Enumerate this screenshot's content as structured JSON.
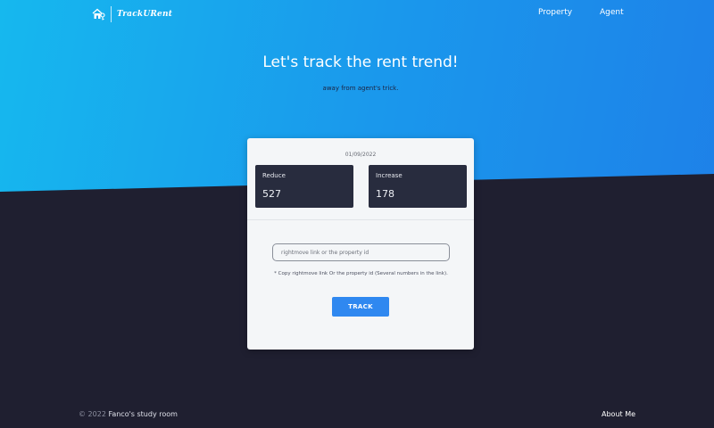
{
  "navbar": {
    "brand_name": "TrackURent",
    "links": [
      {
        "label": "Property"
      },
      {
        "label": "Agent"
      }
    ]
  },
  "hero": {
    "title": "Let's track the rent trend!",
    "subtitle": "away from agent's trick."
  },
  "card": {
    "date": "01/09/2022",
    "stats": {
      "reduce": {
        "label": "Reduce",
        "value": "527"
      },
      "increase": {
        "label": "Increase",
        "value": "178"
      }
    },
    "input": {
      "value": "",
      "placeholder": "rightmove link or the property id"
    },
    "hint": "* Copy rightmove link Or the property id (Several numbers in the link).",
    "button_label": "TRACK"
  },
  "footer": {
    "copyright": "© 2022",
    "owner": "Fanco's study room",
    "about_label": "About Me"
  },
  "colors": {
    "gradient_start": "#16b8ee",
    "gradient_end": "#1e7fe8",
    "dark_background": "#1f1f30",
    "stat_box": "#282c3e",
    "button": "#2f88f0"
  },
  "icons": {
    "brand": "house-key-icon"
  }
}
